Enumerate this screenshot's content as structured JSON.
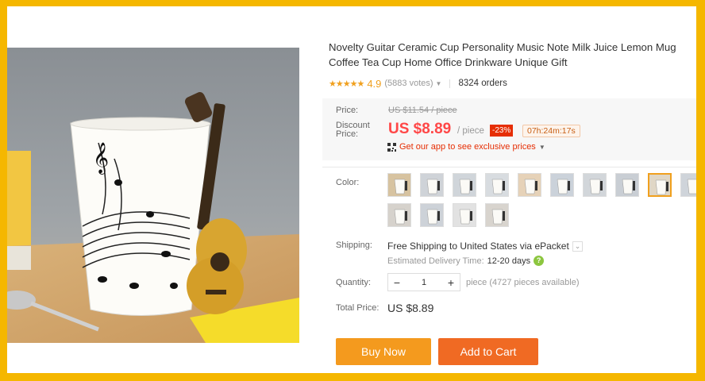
{
  "product": {
    "title": "Novelty Guitar Ceramic Cup Personality Music Note Milk Juice Lemon Mug Coffee Tea Cup Home Office Drinkware Unique Gift",
    "stars": "★★★★★",
    "rating": 4.9,
    "rating_text": "4.9",
    "votes": "(5883 votes)",
    "orders": "8324 orders"
  },
  "pricing": {
    "price_label": "Price:",
    "original_price": "US $11.54 / piece",
    "discount_label_1": "Discount",
    "discount_label_2": "Price:",
    "price": "US $8.89",
    "per_piece": "/ piece",
    "discount": "-23%",
    "timer": "07h:24m:17s",
    "app_promo": "Get our app to see exclusive prices"
  },
  "color": {
    "label": "Color:",
    "selected_index": 8,
    "swatch_count": 14
  },
  "shipping": {
    "label": "Shipping:",
    "method": "Free Shipping to United States via ePacket",
    "estimate_label": "Estimated Delivery Time:",
    "estimate": "12-20 days"
  },
  "quantity": {
    "label": "Quantity:",
    "minus": "−",
    "value": "1",
    "plus": "+",
    "available": "piece (4727 pieces available)"
  },
  "total": {
    "label": "Total Price:",
    "value": "US $8.89"
  },
  "actions": {
    "buy_now": "Buy Now",
    "add_to_cart": "Add to Cart"
  },
  "colors": {
    "frame": "#f5b700",
    "price_red": "#ff4747",
    "star_orange": "#f0a01e",
    "buy_now": "#f49a1e",
    "add_to_cart": "#f06a23"
  }
}
